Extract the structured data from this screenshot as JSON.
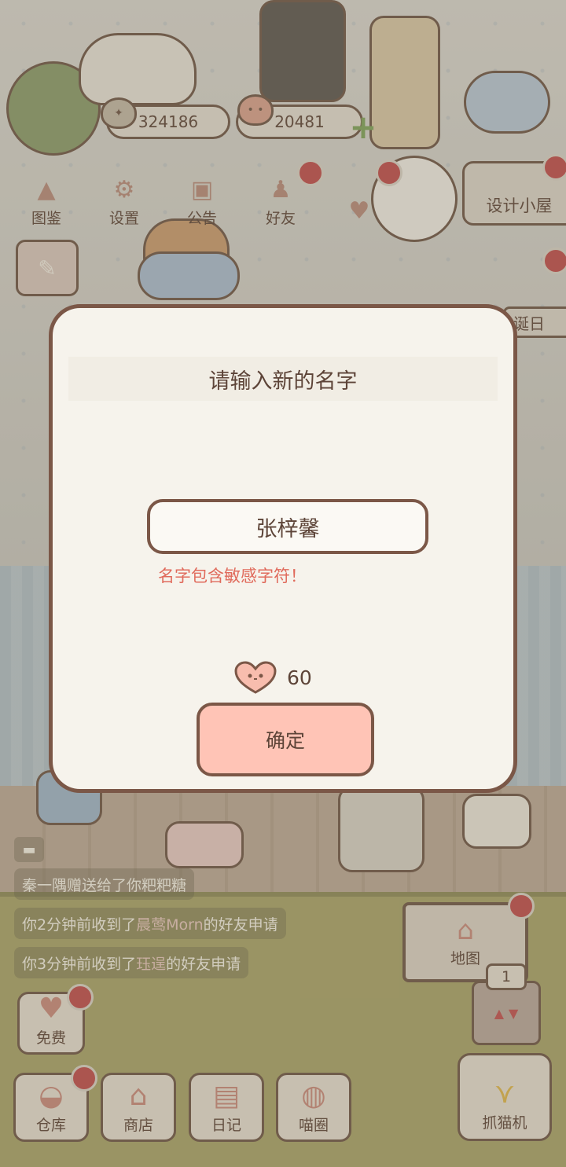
{
  "resources": {
    "coins": "324186",
    "hearts": "20481"
  },
  "menu": {
    "items": [
      {
        "label": "图鉴",
        "icon": "cat-head-icon"
      },
      {
        "label": "设置",
        "icon": "gear-icon"
      },
      {
        "label": "公告",
        "icon": "gift-icon"
      },
      {
        "label": "好友",
        "icon": "friends-icon"
      },
      {
        "label": "",
        "icon": "hearts-icon"
      }
    ],
    "design_room": "设计小屋",
    "birthday_tag": "诞日"
  },
  "notifications": [
    {
      "prefix": "秦一隅赠送给了你粑粑糖",
      "highlight": "",
      "suffix": ""
    },
    {
      "prefix": "你2分钟前收到了",
      "highlight": "晨莺Morn",
      "suffix": "的好友申请"
    },
    {
      "prefix": "你3分钟前收到了",
      "highlight": "珏逞",
      "suffix": "的好友申请"
    }
  ],
  "bottom": {
    "free_label": "免费",
    "warehouse_label": "仓库",
    "shop_label": "商店",
    "diary_label": "日记",
    "meowcircle_label": "喵圈",
    "map_label": "地图",
    "floor_number": "1",
    "claw_label": "抓猫机"
  },
  "dialog": {
    "title": "请输入新的名字",
    "input_value": "张梓馨",
    "error": "名字包含敏感字符！",
    "cost": "60",
    "confirm_label": "确定"
  },
  "colors": {
    "accent": "#ffc4b6",
    "border": "#7b5747",
    "error": "#e06a5b",
    "badge": "#c04b4b"
  }
}
